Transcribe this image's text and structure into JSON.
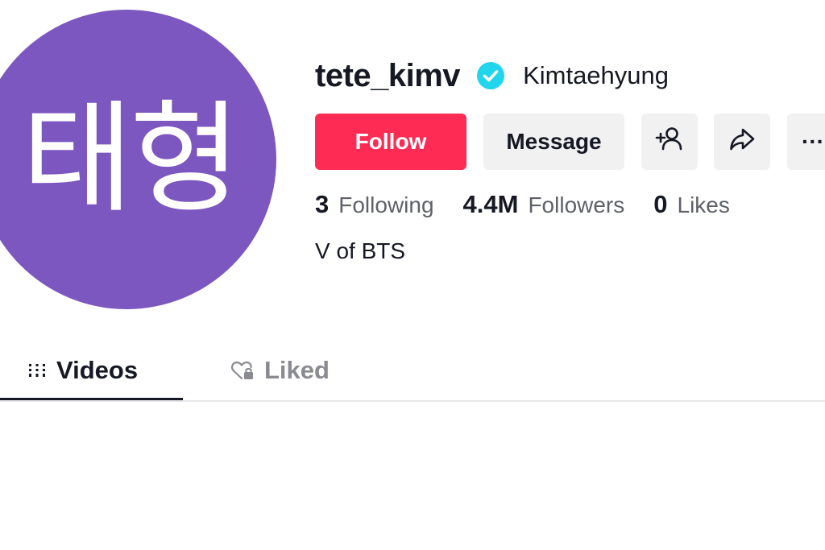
{
  "profile": {
    "avatar_text": "태형",
    "avatar_color": "#7c57bf",
    "username": "tete_kimv",
    "verified_icon": "verified-badge-icon",
    "verified_color": "#20d5ec",
    "nickname": "Kimtaehyung",
    "bio": "V of BTS"
  },
  "actions": {
    "follow_label": "Follow",
    "follow_color": "#fe2c55",
    "message_label": "Message",
    "add_friend_icon": "add-user-icon",
    "share_icon": "share-icon",
    "more_icon": "more-dots-icon",
    "more_label": "···"
  },
  "stats": {
    "following_count": "3",
    "following_label": "Following",
    "followers_count": "4.4M",
    "followers_label": "Followers",
    "likes_count": "0",
    "likes_label": "Likes"
  },
  "tabs": {
    "videos_label": "Videos",
    "videos_icon": "grid-lines-icon",
    "liked_label": "Liked",
    "liked_icon": "heart-lock-icon",
    "active": "Videos"
  }
}
